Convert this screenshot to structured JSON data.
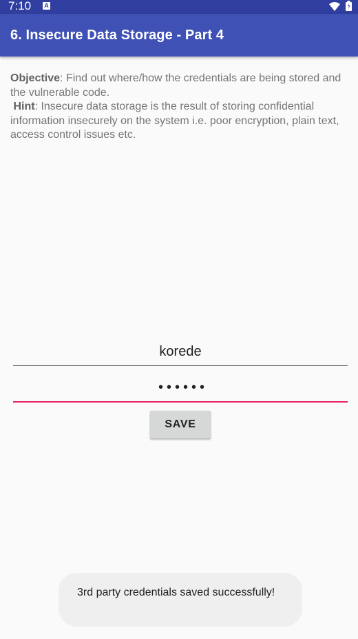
{
  "status_bar": {
    "time": "7:10",
    "notification_icon": "a-icon",
    "wifi_icon": "wifi-icon",
    "battery_icon": "battery-icon"
  },
  "app_bar": {
    "title": "6. Insecure Data Storage - Part 4",
    "color": "#3f51b5",
    "status_color": "#303f9f"
  },
  "description": {
    "objective_label": "Objective",
    "objective_text": ": Find out where/how the credentials are being stored and the vulnerable code.",
    "hint_label": "Hint",
    "hint_text": ": Insecure data storage is the result of storing confidential information insecurely on the system i.e. poor encryption, plain text, access control issues etc."
  },
  "form": {
    "username_value": "korede",
    "password_value": "••••••",
    "save_label": "SAVE",
    "focus_color": "#e91e63"
  },
  "toast": {
    "message": "3rd party credentials saved successfully!"
  }
}
